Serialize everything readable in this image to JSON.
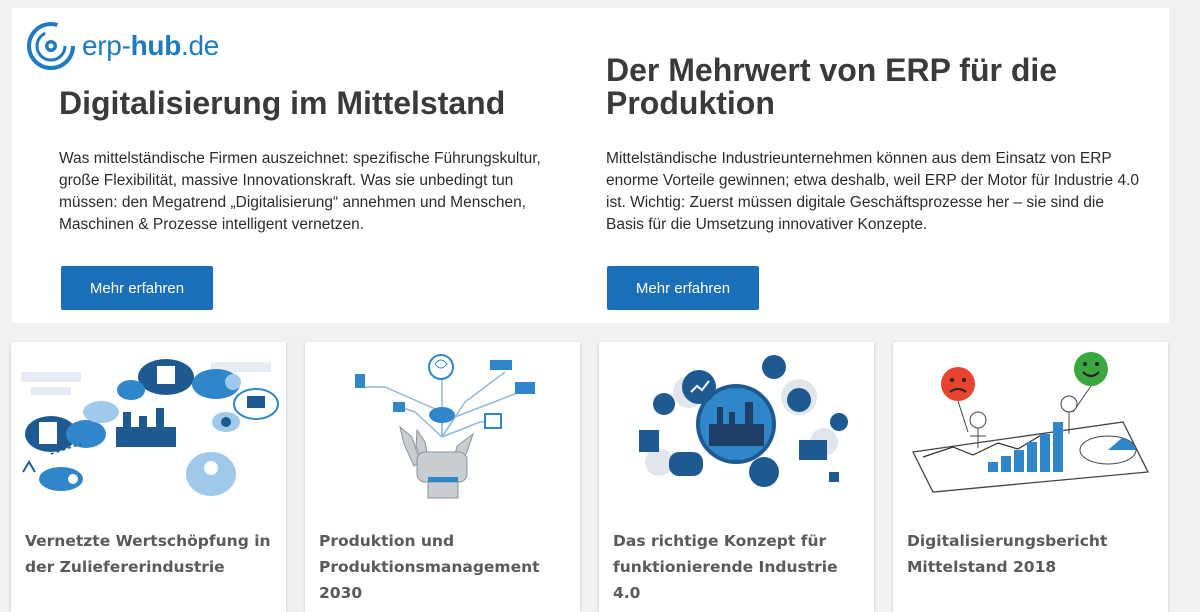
{
  "brand": {
    "prefix": "erp-",
    "bold": "hub",
    "suffix": ".de"
  },
  "colors": {
    "primary": "#1b6fb8",
    "background": "#f1f1f1",
    "headline": "#3a3a3a"
  },
  "features": [
    {
      "headline": "Digitalisierung im Mittelstand",
      "text": "Was mittelständische Firmen auszeichnet: spezifische Führungskultur, große Flexibilität, massive Innovationskraft. Was sie unbedingt tun müssen: den Megatrend „Digitalisierung“ annehmen und Menschen, Maschinen & Prozesse intelligent vernetzen.",
      "button": "Mehr erfahren"
    },
    {
      "headline": "Der Mehrwert von ERP für die Produktion",
      "text": "Mittelständische Industrieunternehmen können aus dem Einsatz von ERP enorme Vorteile gewinnen; etwa deshalb, weil ERP der Motor für Industrie 4.0 ist. Wichtig: Zuerst müssen digitale Geschäftsprozesse her – sie sind die Basis für die Umsetzung innovativer Konzepte.",
      "button": "Mehr erfahren"
    }
  ],
  "cards": [
    {
      "title": "Vernetzte Wertschöpfung in der Zuliefererindustrie",
      "icon": "cloud-network-illustration"
    },
    {
      "title": "Produktion und Produktionsmanagement 2030",
      "icon": "robot-hand-illustration"
    },
    {
      "title": "Das richtige Konzept für funktionierende Industrie 4.0",
      "icon": "factory-network-illustration"
    },
    {
      "title": "Digitalisierungsbericht Mittelstand 2018",
      "icon": "growth-chart-illustration"
    }
  ]
}
